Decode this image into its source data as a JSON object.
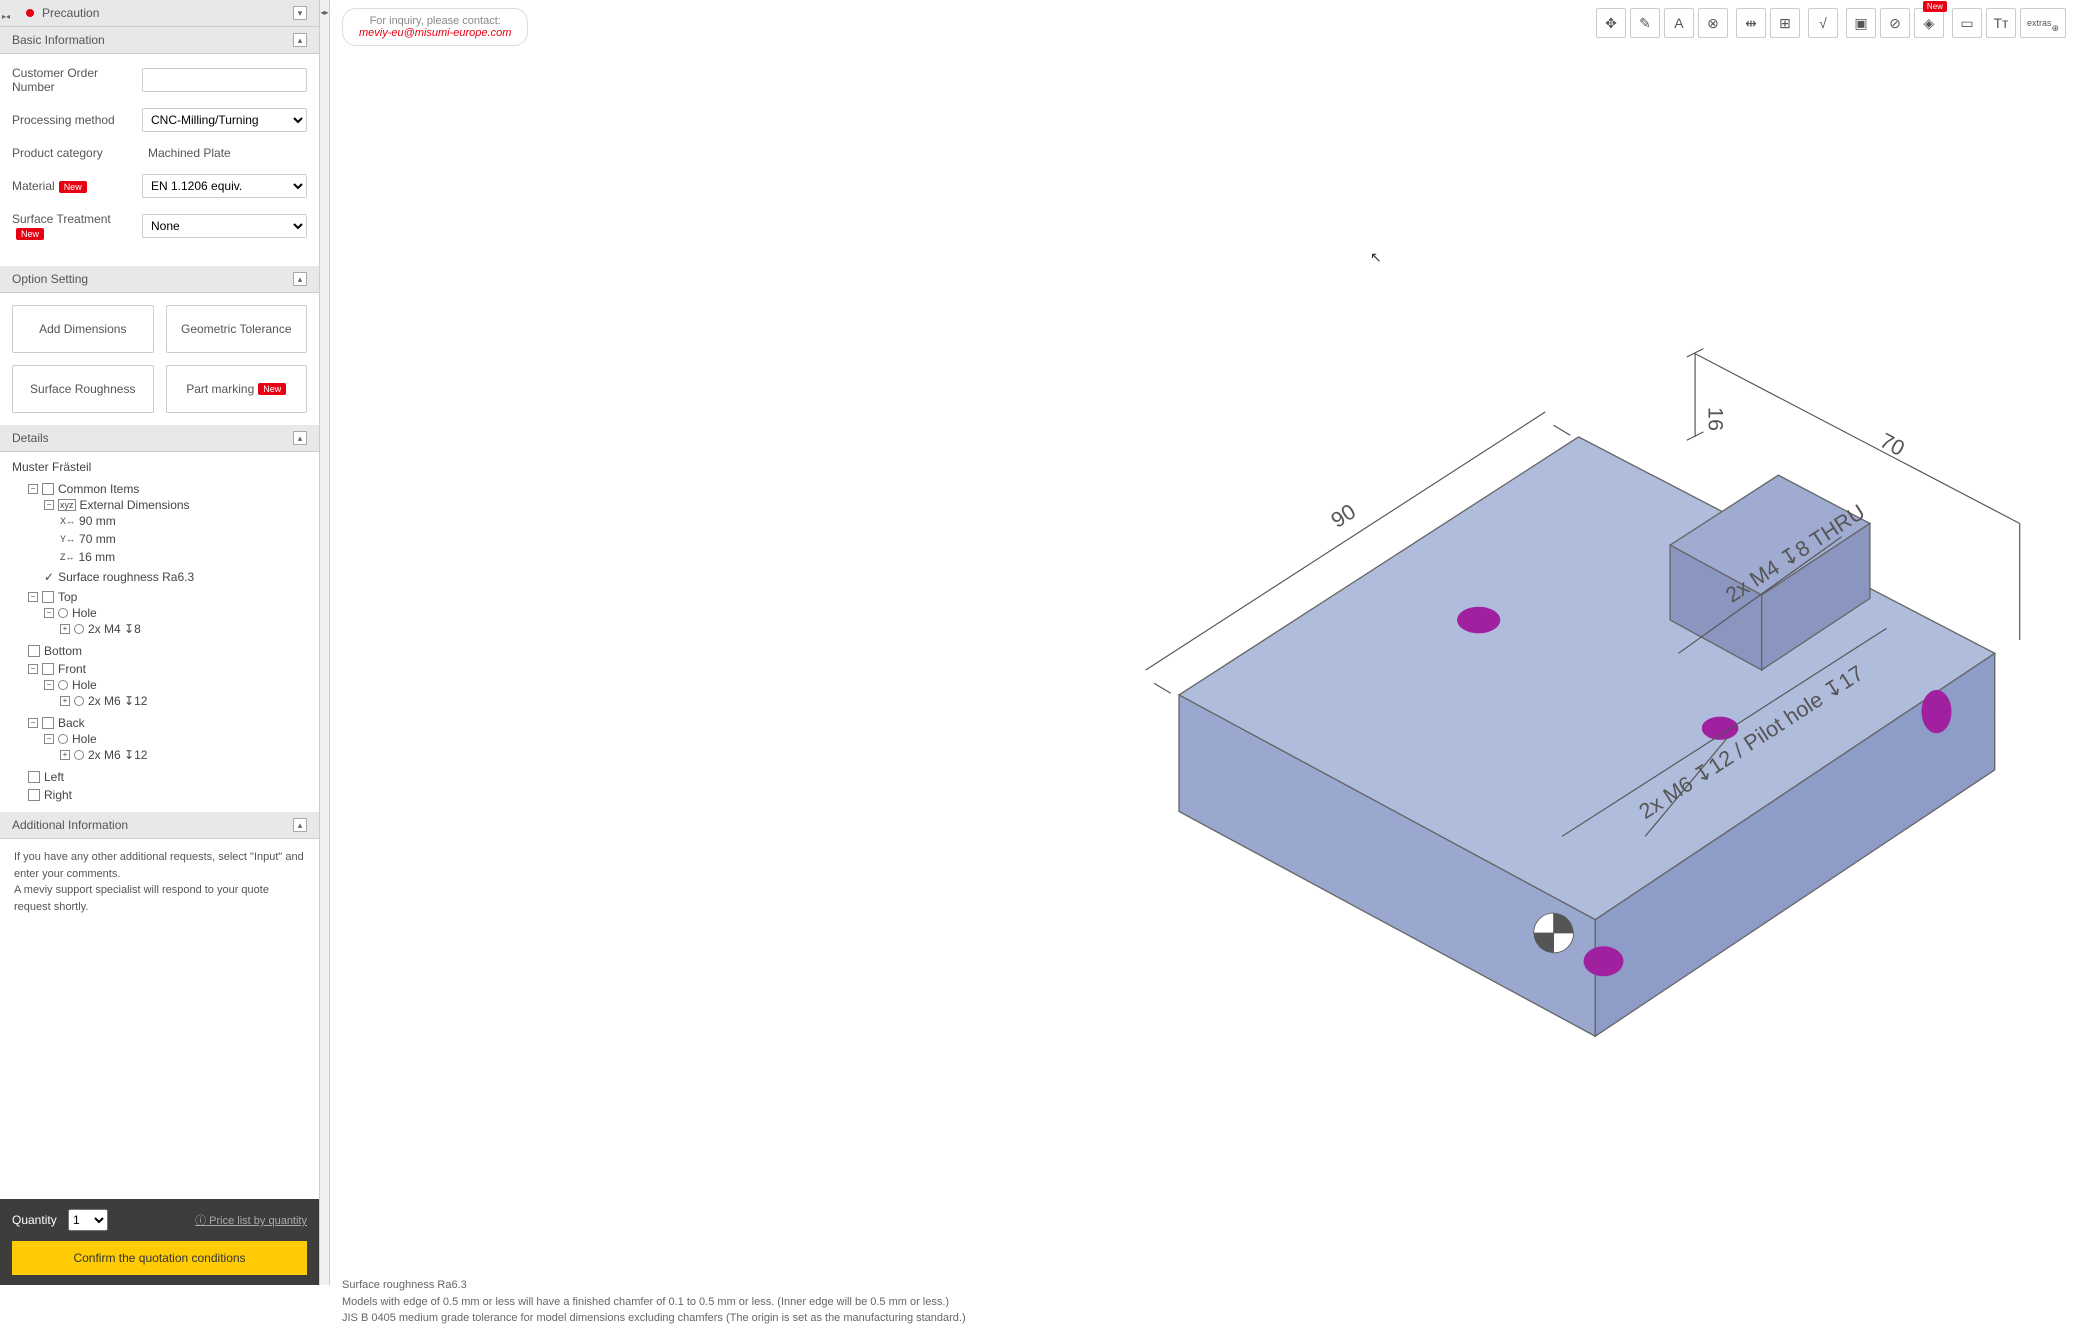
{
  "precaution": {
    "title": "Precaution"
  },
  "sections": {
    "basic_info": "Basic Information",
    "option_setting": "Option Setting",
    "details": "Details",
    "additional_info": "Additional Information"
  },
  "basic": {
    "order_num_label": "Customer Order Number",
    "order_num_value": "",
    "processing_label": "Processing method",
    "processing_value": "CNC-Milling/Turning",
    "category_label": "Product category",
    "category_value": "Machined Plate",
    "material_label": "Material",
    "material_value": "EN 1.1206 equiv.",
    "treatment_label": "Surface Treatment",
    "treatment_value": "None",
    "new_badge": "New"
  },
  "options": {
    "add_dim": "Add Dimensions",
    "geo_tol": "Geometric Tolerance",
    "surf_rough": "Surface Roughness",
    "part_mark": "Part marking"
  },
  "details": {
    "part_name": "Muster Frästeil",
    "common_items": "Common Items",
    "ext_dim": "External Dimensions",
    "dim_x": "90 mm",
    "dim_y": "70 mm",
    "dim_z": "16 mm",
    "surf_rough": "Surface roughness Ra6.3",
    "faces": {
      "top": "Top",
      "bottom": "Bottom",
      "front": "Front",
      "back": "Back",
      "left": "Left",
      "right": "Right"
    },
    "hole": "Hole",
    "hole_top": "2x M4 ↧8",
    "hole_front": "2x M6 ↧12",
    "hole_back": "2x M6 ↧12"
  },
  "additional": {
    "line1": "If you have any other additional requests, select \"Input\" and enter your comments.",
    "line2": "A meviy support specialist will respond to your quote request shortly."
  },
  "footer": {
    "qty_label": "Quantity",
    "qty_value": "1",
    "price_link": "Price list by quantity",
    "confirm": "Confirm the quotation conditions"
  },
  "inquiry": {
    "line1": "For inquiry, please contact:",
    "email": "meviy-eu@misumi-europe.com"
  },
  "toolbar": {
    "new_badge": "New",
    "extras": "extras"
  },
  "model": {
    "dim_90": "90",
    "dim_70": "70",
    "dim_16": "16",
    "callout_m4": "2x M4 ↧8 THRU",
    "callout_m6": "2x M6 ↧12 / Pilot hole ↧17"
  },
  "notes": {
    "n1": "Surface roughness Ra6.3",
    "n2": "Models with edge of 0.5 mm or less will have a finished chamfer of 0.1 to 0.5 mm or less. (Inner edge will be 0.5 mm or less.)",
    "n3": "JIS B 0405 medium grade tolerance for model dimensions excluding chamfers (The origin is set as the manufacturing standard.)"
  }
}
